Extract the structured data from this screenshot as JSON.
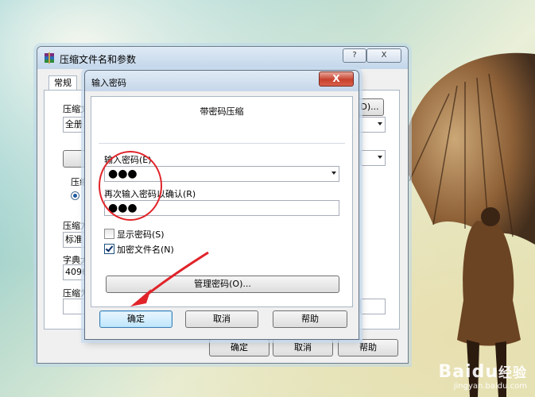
{
  "main_dialog": {
    "title": "压缩文件名和参数",
    "help_btn": "?",
    "close_btn": "X",
    "tabs": [
      "常规"
    ],
    "labels": {
      "archive_name": "压缩文",
      "update_mode": "全册",
      "compress_group": "压缩",
      "compress_format": "压缩方",
      "method_value": "标准",
      "dictionary": "字典大",
      "dict_value": "4096",
      "split": "压缩为",
      "browse_btn": "D)..."
    },
    "buttons": {
      "ok": "确定",
      "cancel": "取消",
      "help": "帮助"
    }
  },
  "password_dialog": {
    "title": "输入密码",
    "close_btn": "X",
    "heading": "带密码压缩",
    "enter_label": "输入密码(E)",
    "enter_value": "●●●",
    "confirm_label": "再次输入密码以确认(R)",
    "confirm_value": "●●●",
    "show_password": {
      "label": "显示密码(S)",
      "checked": false
    },
    "encrypt_names": {
      "label": "加密文件名(N)",
      "checked": true
    },
    "manage_btn": "管理密码(O)...",
    "buttons": {
      "ok": "确定",
      "cancel": "取消",
      "help": "帮助"
    }
  },
  "watermark": {
    "brand": "Baidu",
    "suffix": "经验",
    "url": "jingyan.baidu.com"
  },
  "colors": {
    "annotation": "#e0242a",
    "accent": "#3c7fb1"
  }
}
